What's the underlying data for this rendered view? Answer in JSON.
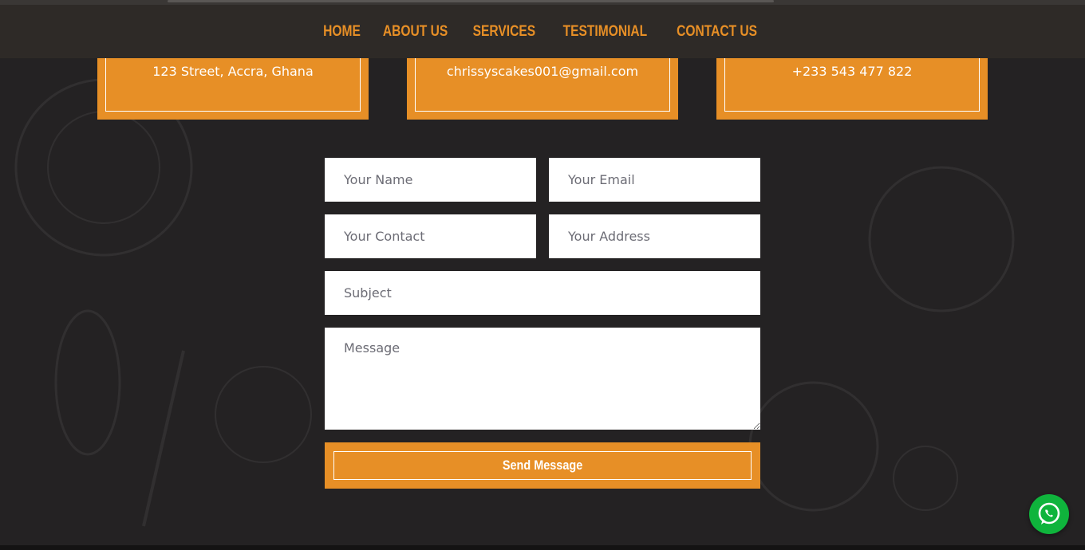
{
  "nav": {
    "items": [
      {
        "label": "HOME"
      },
      {
        "label": "ABOUT US"
      },
      {
        "label": "SERVICES"
      },
      {
        "label": "TESTIMONIAL"
      },
      {
        "label": "CONTACT US"
      }
    ]
  },
  "contact_info": {
    "address": "123 Street, Accra, Ghana",
    "email": "chrissyscakes001@gmail.com",
    "phone": "+233 543 477 822"
  },
  "form": {
    "name_placeholder": "Your Name",
    "email_placeholder": "Your Email",
    "contact_placeholder": "Your Contact",
    "address_placeholder": "Your Address",
    "subject_placeholder": "Subject",
    "message_placeholder": "Message",
    "submit_label": "Send Message"
  },
  "floating": {
    "whatsapp_icon": "whatsapp-icon"
  },
  "colors": {
    "accent": "#e78f26",
    "background": "#242223",
    "navbar": "#2e2a27",
    "whatsapp": "#0fb43c"
  }
}
